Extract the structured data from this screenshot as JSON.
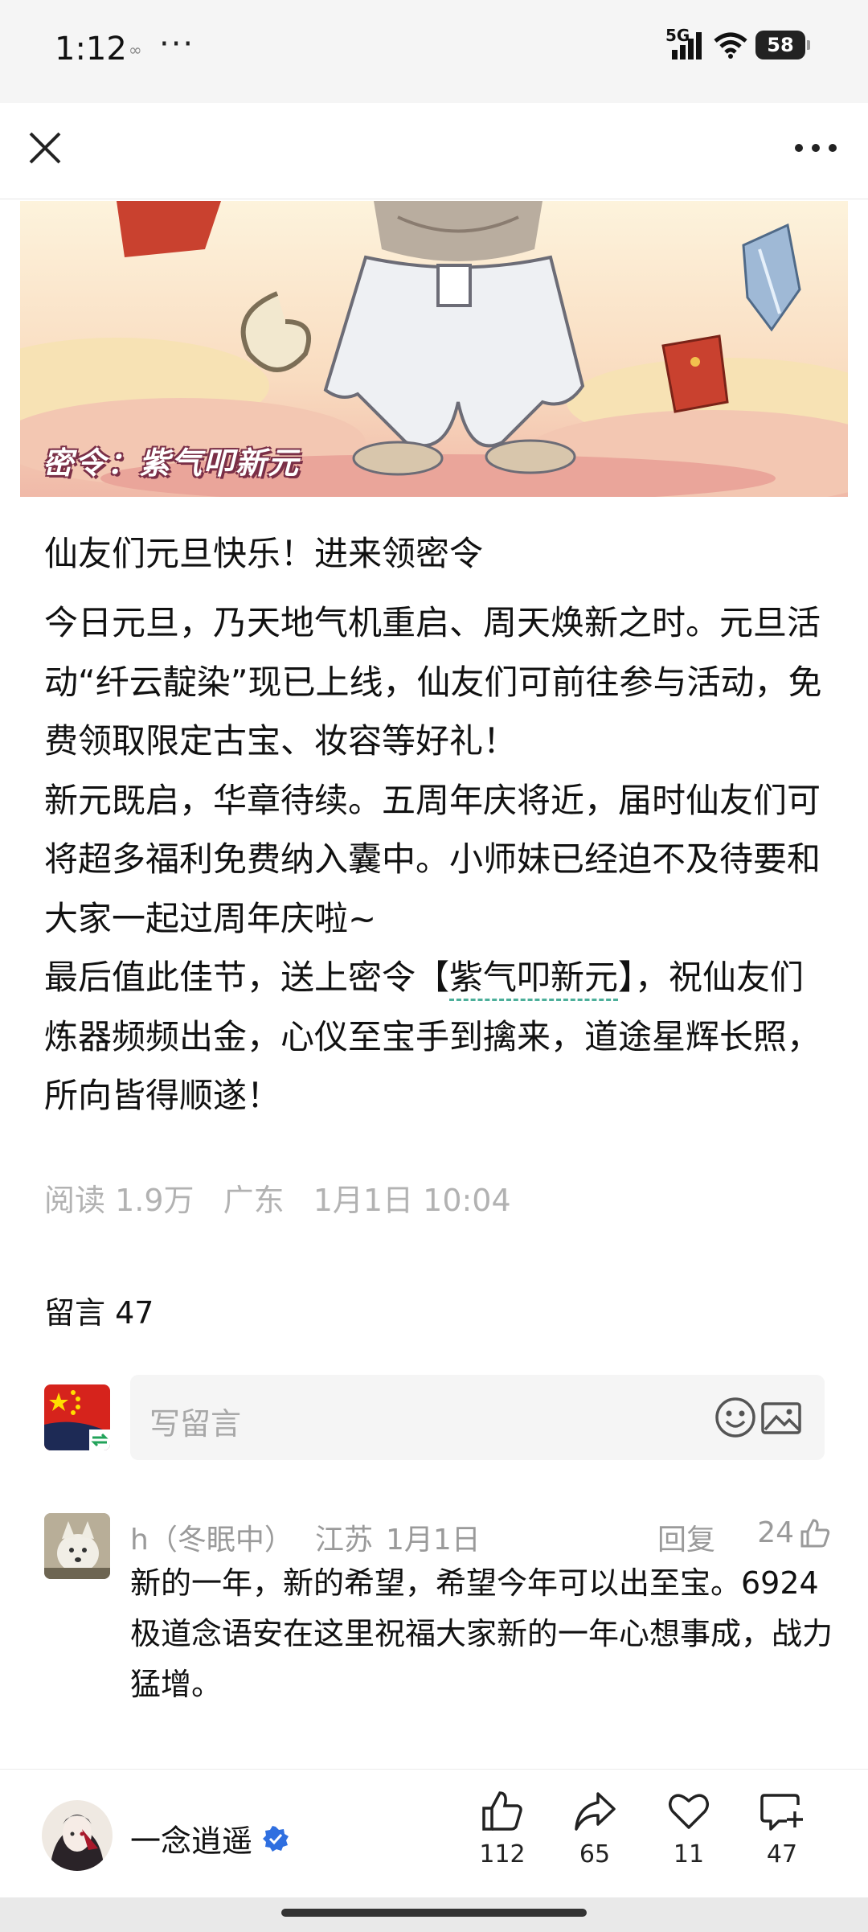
{
  "status_bar": {
    "time": "1:12",
    "small_icon": "∞",
    "more_dots": "···",
    "network": "5G",
    "battery": "58"
  },
  "banner": {
    "tag": "密令：紫气叩新元"
  },
  "article": {
    "title": "仙友们元旦快乐！进来领密令",
    "para1": "今日元旦，乃天地气机重启、周天焕新之时。元旦活动“纤云靛染”现已上线，仙友们可前往参与活动，免费领取限定古宝、妆容等好礼！",
    "para2": "新元既启，华章待续。五周年庆将近，届时仙友们可将超多福利免费纳入囊中。小师妹已经迫不及待要和大家一起过周年庆啦~",
    "para3_before": "最后值此佳节，送上密令【",
    "para3_code": "紫气叩新元",
    "para3_after": "】，祝仙友们炼器频频出金，心仪至宝手到擒来，道途星辉长照，所向皆得顺遂！"
  },
  "meta": {
    "reads": "阅读 1.9万",
    "region": "广东",
    "datetime": "1月1日 10:04"
  },
  "comments": {
    "header": "留言 47",
    "input_placeholder": "写留言",
    "items": [
      {
        "name": "h（冬眠中）",
        "location": "江苏",
        "date": "1月1日",
        "reply_label": "回复",
        "likes": "24",
        "text": "新的一年，新的希望，希望今年可以出至宝。6924极道念语安在这里祝福大家新的一年心想事成，战力猛增。"
      }
    ]
  },
  "bottom_bar": {
    "author": "一念逍遥",
    "likes": "112",
    "shares": "65",
    "favorites": "11",
    "comments": "47"
  }
}
